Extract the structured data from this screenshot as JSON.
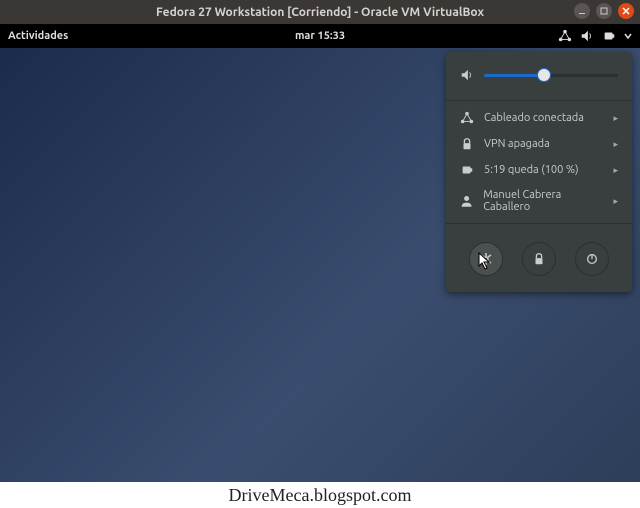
{
  "vm": {
    "title": "Fedora 27 Workstation [Corriendo] - Oracle VM VirtualBox"
  },
  "topbar": {
    "activities": "Actividades",
    "clock": "mar 15:33"
  },
  "volume": {
    "level": 45
  },
  "menu": {
    "network": "Cableado conectada",
    "vpn": "VPN apagada",
    "battery": "5:19 queda (100 %)",
    "user": "Manuel Cabrera Caballero"
  },
  "caption": "DriveMeca.blogspot.com"
}
